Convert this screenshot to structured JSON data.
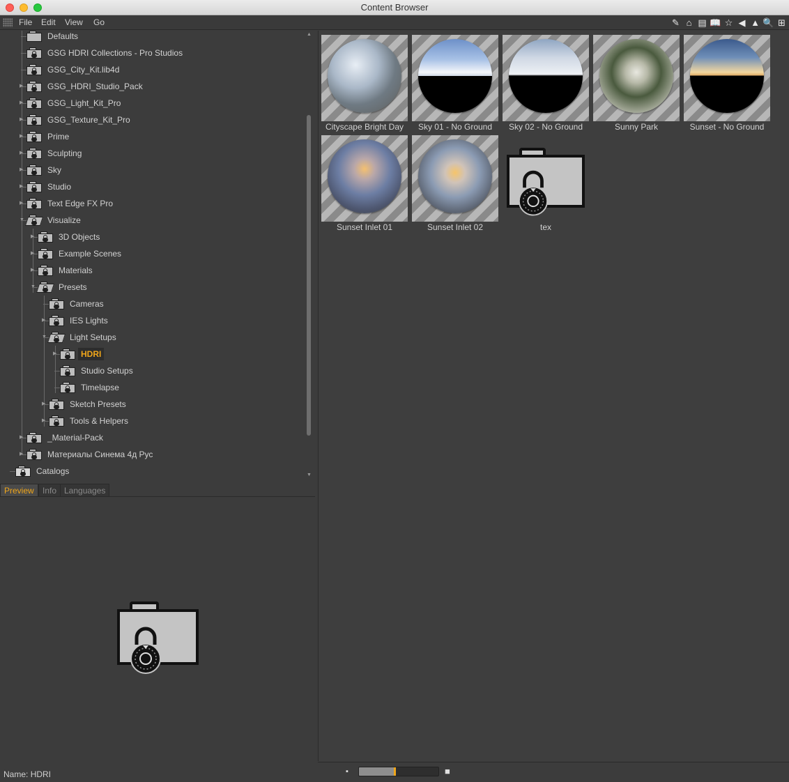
{
  "window": {
    "title": "Content Browser"
  },
  "menu": [
    "File",
    "Edit",
    "View",
    "Go"
  ],
  "toolbar": [
    {
      "name": "edit-icon",
      "glyph": "✎"
    },
    {
      "name": "home-icon",
      "glyph": "⌂"
    },
    {
      "name": "jar-icon",
      "glyph": "▤"
    },
    {
      "name": "book-icon",
      "glyph": "📖"
    },
    {
      "name": "star-icon",
      "glyph": "☆"
    },
    {
      "name": "back-arrow-icon",
      "glyph": "◀"
    },
    {
      "name": "forward-arrow-icon",
      "glyph": "▲"
    },
    {
      "name": "search-icon",
      "glyph": "🔍"
    },
    {
      "name": "add-icon",
      "glyph": "⊞"
    }
  ],
  "tree": [
    {
      "label": "Defaults",
      "indent": 0,
      "icon": "plain",
      "arrow": ""
    },
    {
      "label": "GSG HDRI Collections - Pro Studios",
      "indent": 0,
      "icon": "lock",
      "arrow": ""
    },
    {
      "label": "GSG_City_Kit.lib4d",
      "indent": 0,
      "icon": "lock",
      "arrow": ""
    },
    {
      "label": "GSG_HDRI_Studio_Pack",
      "indent": 0,
      "icon": "lock",
      "arrow": "right"
    },
    {
      "label": "GSG_Light_Kit_Pro",
      "indent": 0,
      "icon": "lock",
      "arrow": "right"
    },
    {
      "label": "GSG_Texture_Kit_Pro",
      "indent": 0,
      "icon": "lock",
      "arrow": "right"
    },
    {
      "label": "Prime",
      "indent": 0,
      "icon": "lock",
      "arrow": "right"
    },
    {
      "label": "Sculpting",
      "indent": 0,
      "icon": "lock",
      "arrow": "right"
    },
    {
      "label": "Sky",
      "indent": 0,
      "icon": "lock",
      "arrow": "right"
    },
    {
      "label": "Studio",
      "indent": 0,
      "icon": "lock",
      "arrow": "right"
    },
    {
      "label": "Text Edge FX Pro",
      "indent": 0,
      "icon": "lock",
      "arrow": "right"
    },
    {
      "label": "Visualize",
      "indent": 0,
      "icon": "open",
      "arrow": "down"
    },
    {
      "label": "3D Objects",
      "indent": 1,
      "icon": "lock",
      "arrow": "right"
    },
    {
      "label": "Example Scenes",
      "indent": 1,
      "icon": "lock",
      "arrow": "right"
    },
    {
      "label": "Materials",
      "indent": 1,
      "icon": "lock",
      "arrow": "right"
    },
    {
      "label": "Presets",
      "indent": 1,
      "icon": "open",
      "arrow": "down"
    },
    {
      "label": "Cameras",
      "indent": 2,
      "icon": "lock",
      "arrow": ""
    },
    {
      "label": "IES Lights",
      "indent": 2,
      "icon": "lock",
      "arrow": "right"
    },
    {
      "label": "Light Setups",
      "indent": 2,
      "icon": "open",
      "arrow": "down"
    },
    {
      "label": "HDRI",
      "indent": 3,
      "icon": "lock",
      "arrow": "right",
      "selected": true
    },
    {
      "label": "Studio Setups",
      "indent": 3,
      "icon": "lock",
      "arrow": ""
    },
    {
      "label": "Timelapse",
      "indent": 3,
      "icon": "lock",
      "arrow": ""
    },
    {
      "label": "Sketch Presets",
      "indent": 2,
      "icon": "lock",
      "arrow": "right"
    },
    {
      "label": "Tools & Helpers",
      "indent": 2,
      "icon": "lock",
      "arrow": "right"
    },
    {
      "label": "_Material-Pack",
      "indent": 0,
      "icon": "lock",
      "arrow": "right"
    },
    {
      "label": "Материалы Синема 4д Рус",
      "indent": 0,
      "icon": "lock",
      "arrow": "right"
    },
    {
      "label": "Catalogs",
      "indent": -1,
      "icon": "book",
      "arrow": ""
    }
  ],
  "tabs": [
    "Preview",
    "Info",
    "Languages"
  ],
  "active_tab": "Preview",
  "preview": {
    "name_label": "Name:",
    "name_value": "HDRI"
  },
  "grid": [
    {
      "label": "Cityscape Bright Day",
      "kind": "city"
    },
    {
      "label": "Sky 01 - No Ground",
      "kind": "sky1"
    },
    {
      "label": "Sky 02 - No Ground",
      "kind": "sky2"
    },
    {
      "label": "Sunny Park",
      "kind": "park"
    },
    {
      "label": "Sunset - No Ground",
      "kind": "sunset"
    },
    {
      "label": "Sunset Inlet 01",
      "kind": "inlet1"
    },
    {
      "label": "Sunset Inlet 02",
      "kind": "inlet2"
    },
    {
      "label": "tex",
      "kind": "folder"
    }
  ],
  "zoom": {
    "level": 0.45
  },
  "colors": {
    "accent": "#f0a61a",
    "panel": "#3c3c3c"
  }
}
